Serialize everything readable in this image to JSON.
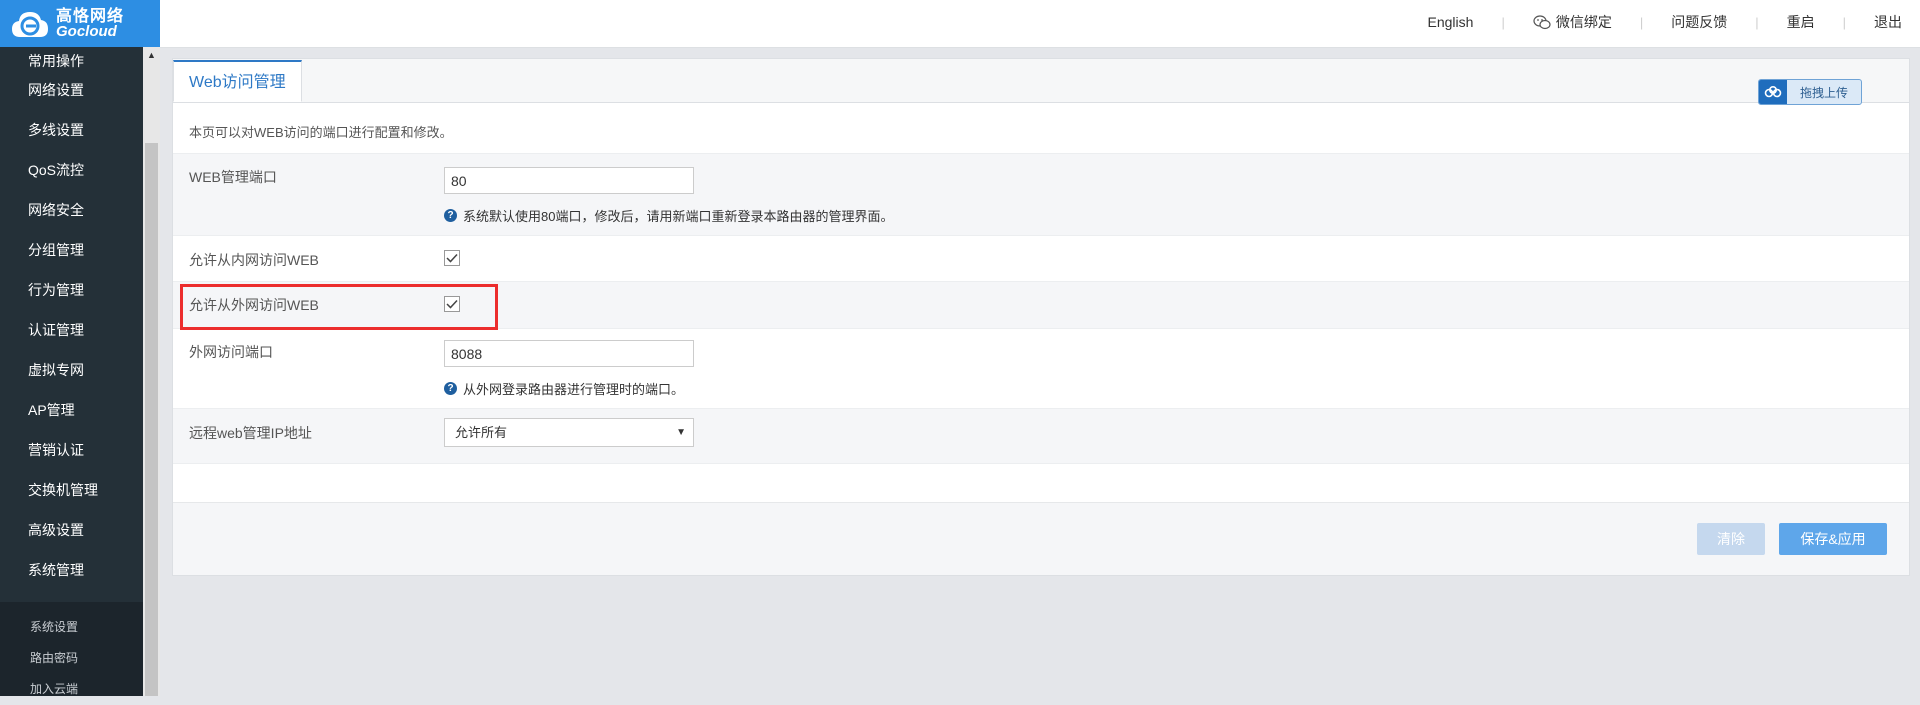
{
  "brand": {
    "name_cn": "高恪网络",
    "name_en": "Gocloud"
  },
  "topnav": {
    "english": "English",
    "wechat": "微信绑定",
    "feedback": "问题反馈",
    "reboot": "重启",
    "logout": "退出"
  },
  "sidebar": {
    "items": [
      "常用操作",
      "网络设置",
      "多线设置",
      "QoS流控",
      "网络安全",
      "分组管理",
      "行为管理",
      "认证管理",
      "虚拟专网",
      "AP管理",
      "营销认证",
      "交换机管理",
      "高级设置",
      "系统管理"
    ],
    "sub_items": [
      "系统设置",
      "路由密码",
      "加入云端"
    ]
  },
  "panel": {
    "tab": "Web访问管理",
    "upload_label": "拖拽上传",
    "description": "本页可以对WEB访问的端口进行配置和修改。"
  },
  "form": {
    "web_port": {
      "label": "WEB管理端口",
      "value": "80",
      "hint": "系统默认使用80端口，修改后，请用新端口重新登录本路由器的管理界面。"
    },
    "allow_lan": {
      "label": "允许从内网访问WEB",
      "checked": true
    },
    "allow_wan": {
      "label": "允许从外网访问WEB",
      "checked": true
    },
    "wan_port": {
      "label": "外网访问端口",
      "value": "8088",
      "hint": "从外网登录路由器进行管理时的端口。"
    },
    "remote_ip": {
      "label": "远程web管理IP地址",
      "selected": "允许所有"
    }
  },
  "buttons": {
    "clear": "清除",
    "save": "保存&应用"
  },
  "colors": {
    "accent": "#2e79c6",
    "highlight": "#ec2d2d",
    "sidebar": "#243038"
  }
}
